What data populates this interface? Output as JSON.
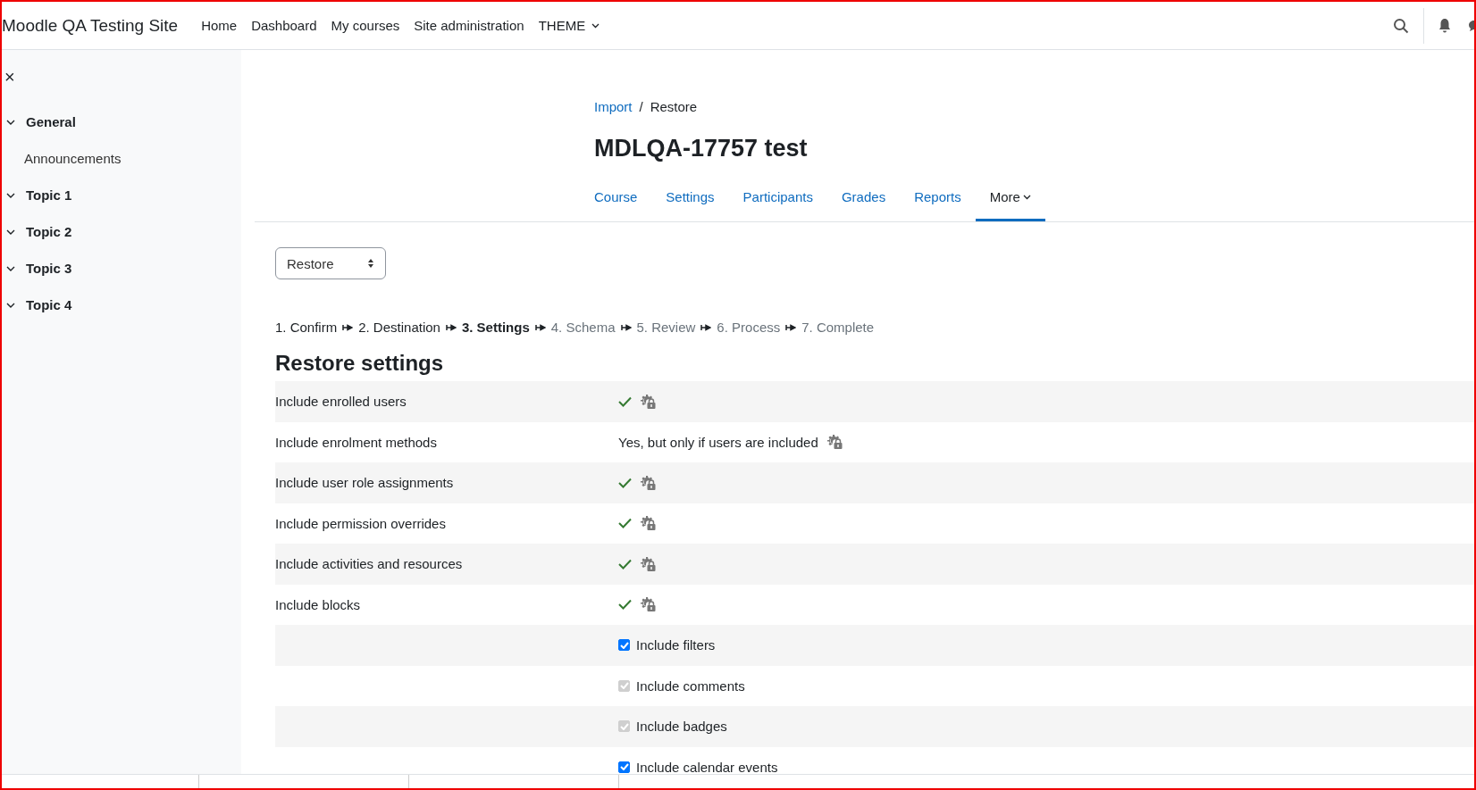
{
  "navbar": {
    "site_name": "Moodle QA Testing Site",
    "links": [
      {
        "label": "Home",
        "dropdown": false
      },
      {
        "label": "Dashboard",
        "dropdown": false
      },
      {
        "label": "My courses",
        "dropdown": false
      },
      {
        "label": "Site administration",
        "dropdown": false
      },
      {
        "label": "THEME",
        "dropdown": true
      }
    ]
  },
  "sidebar": {
    "close": "×",
    "items": [
      {
        "label": "General",
        "kind": "section",
        "expanded": true
      },
      {
        "label": "Announcements",
        "kind": "activity"
      },
      {
        "label": "Topic 1",
        "kind": "section",
        "expanded": true
      },
      {
        "label": "Topic 2",
        "kind": "section",
        "expanded": true
      },
      {
        "label": "Topic 3",
        "kind": "section",
        "expanded": true
      },
      {
        "label": "Topic 4",
        "kind": "section",
        "expanded": true
      }
    ]
  },
  "breadcrumb": [
    {
      "label": "Import",
      "link": true
    },
    {
      "label": "Restore",
      "link": false,
      "separator": "/"
    }
  ],
  "page_title": "MDLQA-17757 test",
  "tabs": [
    {
      "label": "Course",
      "selected": false,
      "dropdown": false
    },
    {
      "label": "Settings",
      "selected": false,
      "dropdown": false
    },
    {
      "label": "Participants",
      "selected": false,
      "dropdown": false
    },
    {
      "label": "Grades",
      "selected": false,
      "dropdown": false
    },
    {
      "label": "Reports",
      "selected": false,
      "dropdown": false
    },
    {
      "label": "More",
      "selected": true,
      "dropdown": true
    }
  ],
  "select": {
    "value": "Restore"
  },
  "steps": [
    {
      "label": "1. Confirm",
      "selected": false,
      "disabled": false
    },
    {
      "label": "2. Destination",
      "selected": false,
      "disabled": false
    },
    {
      "label": "3. Settings",
      "selected": true,
      "disabled": false
    },
    {
      "label": "4. Schema",
      "selected": false,
      "disabled": true
    },
    {
      "label": "5. Review",
      "selected": false,
      "disabled": true
    },
    {
      "label": "6. Process",
      "selected": false,
      "disabled": true
    },
    {
      "label": "7. Complete",
      "selected": false,
      "disabled": true
    }
  ],
  "section_title": "Restore settings",
  "settings": [
    {
      "label": "Include enrolled users",
      "kind": "status",
      "locked": true
    },
    {
      "label": "Include enrolment methods",
      "kind": "text",
      "value": "Yes, but only if users are included",
      "locked": true
    },
    {
      "label": "Include user role assignments",
      "kind": "status",
      "locked": true
    },
    {
      "label": "Include permission overrides",
      "kind": "status",
      "locked": true
    },
    {
      "label": "Include activities and resources",
      "kind": "status",
      "locked": true
    },
    {
      "label": "Include blocks",
      "kind": "status",
      "locked": true
    },
    {
      "label": "Include filters",
      "kind": "checkbox",
      "checked": true,
      "disabled": false
    },
    {
      "label": "Include comments",
      "kind": "checkbox",
      "checked": true,
      "disabled": true
    },
    {
      "label": "Include badges",
      "kind": "checkbox",
      "checked": true,
      "disabled": true
    },
    {
      "label": "Include calendar events",
      "kind": "checkbox",
      "checked": true,
      "disabled": false
    }
  ]
}
